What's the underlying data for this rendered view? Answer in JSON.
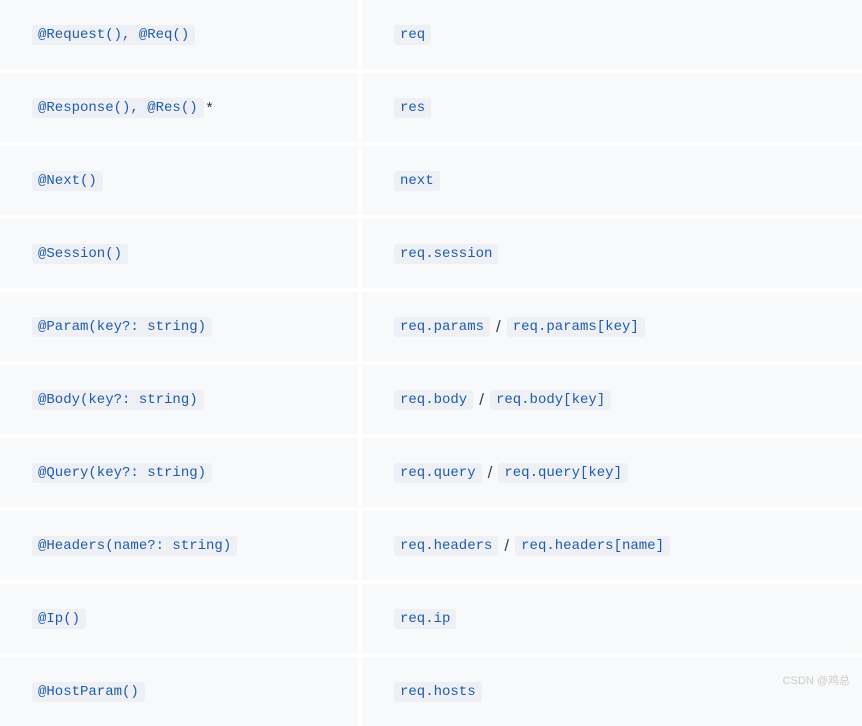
{
  "rows": [
    {
      "decorator": "@Request(), @Req()",
      "suffix": "",
      "values": [
        "req"
      ]
    },
    {
      "decorator": "@Response(), @Res()",
      "suffix": "*",
      "values": [
        "res"
      ]
    },
    {
      "decorator": "@Next()",
      "suffix": "",
      "values": [
        "next"
      ]
    },
    {
      "decorator": "@Session()",
      "suffix": "",
      "values": [
        "req.session"
      ]
    },
    {
      "decorator": "@Param(key?: string)",
      "suffix": "",
      "values": [
        "req.params",
        "req.params[key]"
      ]
    },
    {
      "decorator": "@Body(key?: string)",
      "suffix": "",
      "values": [
        "req.body",
        "req.body[key]"
      ]
    },
    {
      "decorator": "@Query(key?: string)",
      "suffix": "",
      "values": [
        "req.query",
        "req.query[key]"
      ]
    },
    {
      "decorator": "@Headers(name?: string)",
      "suffix": "",
      "values": [
        "req.headers",
        "req.headers[name]"
      ]
    },
    {
      "decorator": "@Ip()",
      "suffix": "",
      "values": [
        "req.ip"
      ]
    },
    {
      "decorator": "@HostParam()",
      "suffix": "",
      "values": [
        "req.hosts"
      ]
    }
  ],
  "separator": "/",
  "watermark": "CSDN @鸡总"
}
